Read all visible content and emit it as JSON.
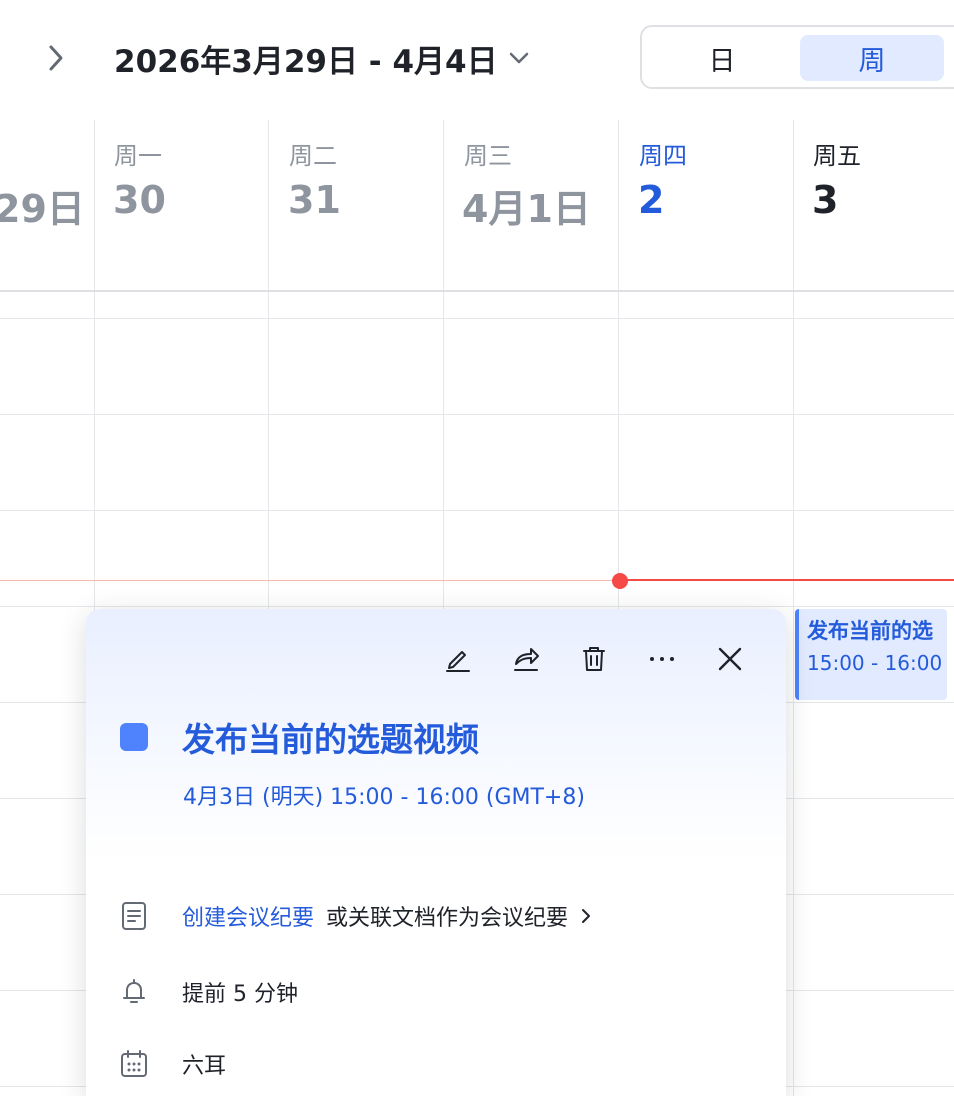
{
  "header": {
    "date_range": "2026年3月29日 - 4月4日",
    "view_options": {
      "day": "日",
      "week": "周"
    },
    "selected_view": "week"
  },
  "days": [
    {
      "weekday": "",
      "date": "29日"
    },
    {
      "weekday": "周一",
      "date": "30"
    },
    {
      "weekday": "周二",
      "date": "31"
    },
    {
      "weekday": "周三",
      "date": "4月1日"
    },
    {
      "weekday": "周四",
      "date": "2"
    },
    {
      "weekday": "周五",
      "date": "3"
    }
  ],
  "event_block": {
    "title": "发布当前的选",
    "time": "15:00 - 16:00"
  },
  "popup": {
    "title": "发布当前的选题视频",
    "time": "4月3日 (明天) 15:00 - 16:00 (GMT+8)",
    "color": "#4e83fd",
    "notes_link": "创建会议纪要",
    "notes_alt": "或关联文档作为会议纪要",
    "reminder": "提前 5 分钟",
    "calendar": "六耳"
  },
  "colors": {
    "accent": "#245bdb",
    "today": "#245bdb",
    "now_indicator": "#f54a45",
    "event": "#4e83fd"
  }
}
